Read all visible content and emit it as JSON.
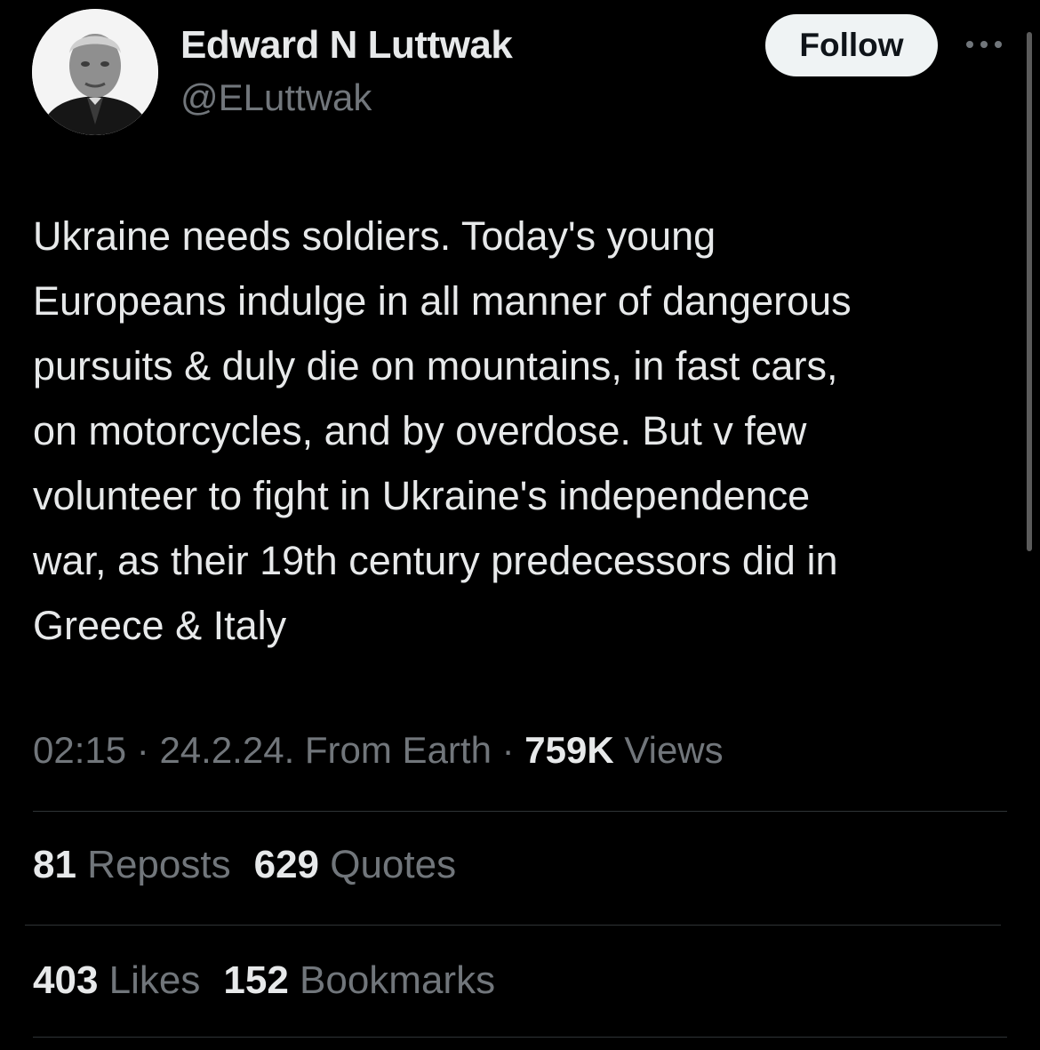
{
  "user": {
    "display_name": "Edward N Luttwak",
    "handle": "@ELuttwak",
    "avatar_icon": "profile-photo"
  },
  "actions": {
    "follow_label": "Follow",
    "more_icon": "ellipsis-icon"
  },
  "tweet": {
    "lines": [
      "Ukraine needs soldiers. Today's young",
      "Europeans indulge in all manner of dangerous",
      "pursuits & duly die on mountains, in fast cars,",
      "on motorcycles, and by overdose. But v few",
      "volunteer to fight in Ukraine's independence",
      "war, as their 19th century predecessors did in",
      "Greece & Italy"
    ]
  },
  "meta": {
    "time": "02:15",
    "sep1": " · ",
    "date": "24.2.24. From Earth",
    "sep2": " · ",
    "views_count": "759K",
    "views_label": " Views"
  },
  "stats": {
    "reposts_count": "81",
    "reposts_label": " Reposts",
    "quotes_count": "629",
    "quotes_label": " Quotes",
    "likes_count": "403",
    "likes_label": " Likes",
    "bookmarks_count": "152",
    "bookmarks_label": " Bookmarks"
  },
  "colors": {
    "background": "#000000",
    "primary_text": "#e7e9ea",
    "secondary_text": "#71767b",
    "divider": "#2f3336",
    "follow_button_bg": "#eff3f4",
    "follow_button_text": "#0f1419"
  }
}
